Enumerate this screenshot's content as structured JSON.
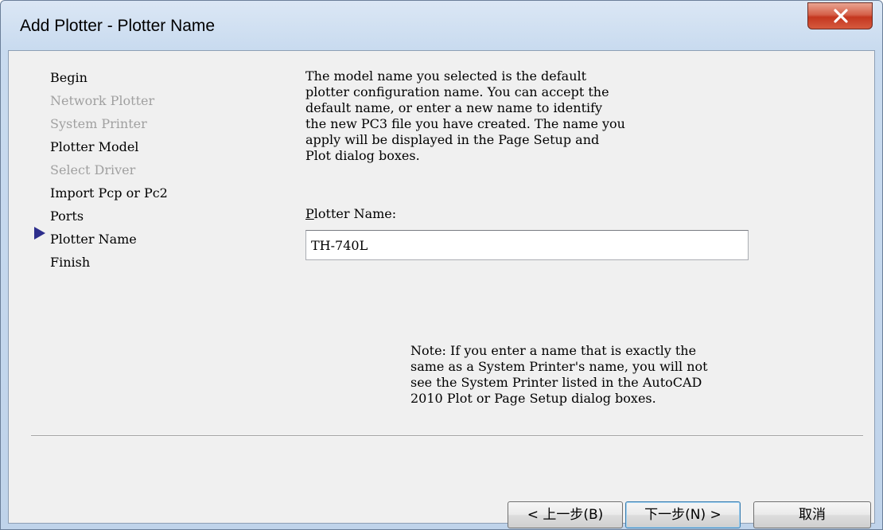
{
  "window": {
    "title": "Add Plotter - Plotter Name",
    "close_glyph": "x"
  },
  "steps": [
    {
      "label": "Begin",
      "state": "enabled"
    },
    {
      "label": "Network Plotter",
      "state": "disabled"
    },
    {
      "label": "System Printer",
      "state": "disabled"
    },
    {
      "label": "Plotter Model",
      "state": "enabled"
    },
    {
      "label": "Select Driver",
      "state": "disabled"
    },
    {
      "label": "Import Pcp or Pc2",
      "state": "enabled"
    },
    {
      "label": "Ports",
      "state": "enabled"
    },
    {
      "label": "Plotter Name",
      "state": "current"
    },
    {
      "label": "Finish",
      "state": "enabled"
    }
  ],
  "intro_text": "The model name you selected is the default\nplotter configuration name. You can accept the\ndefault name, or enter a new name to identify\nthe new PC3 file you have created. The name you\napply will be displayed in the Page Setup and\nPlot dialog boxes.",
  "plotter_name": {
    "label_mnemonic": "P",
    "label_rest": "lotter Name:",
    "value": "TH-740L"
  },
  "note_text": "Note: If you enter a name that is exactly the\nsame as a System Printer's name, you will not\nsee the System Printer listed in the AutoCAD\n2010 Plot or Page Setup dialog boxes.",
  "buttons": {
    "back": "< 上一步(B)",
    "next": "下一步(N) >",
    "cancel": "取消"
  },
  "colors": {
    "current_step_arrow": "#2d2e8c",
    "disabled_text": "#a0a0a0",
    "close_button": "#c4371f"
  }
}
